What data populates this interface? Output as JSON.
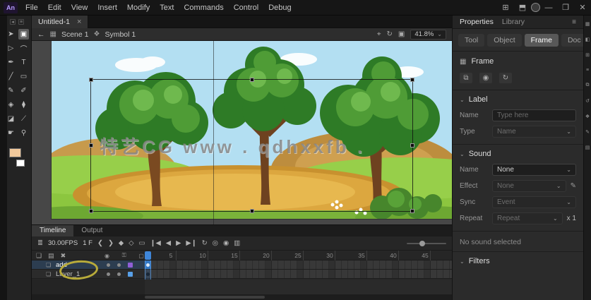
{
  "menubar": {
    "logo": "An",
    "items": [
      "File",
      "Edit",
      "View",
      "Insert",
      "Modify",
      "Text",
      "Commands",
      "Control",
      "Debug"
    ],
    "right_icons": [
      {
        "name": "workspace-icon",
        "glyph": "⊞"
      },
      {
        "name": "quick-share-icon",
        "glyph": "⬒"
      },
      {
        "name": "profile-avatar",
        "glyph": "",
        "avatar": true
      },
      {
        "name": "minimize-button",
        "glyph": "—"
      },
      {
        "name": "restore-button",
        "glyph": "❐"
      },
      {
        "name": "close-button",
        "glyph": "✕"
      }
    ]
  },
  "doc_tab": {
    "title": "Untitled-1",
    "close_glyph": "×"
  },
  "edit_bar": {
    "back_glyph": "←",
    "scene_icon": "▦",
    "scene_label": "Scene 1",
    "symbol_icon": "❖",
    "symbol_label": "Symbol 1",
    "right_icons": [
      {
        "name": "center-stage-icon",
        "glyph": "⌖"
      },
      {
        "name": "rotate-view-icon",
        "glyph": "↻"
      },
      {
        "name": "clip-content-icon",
        "glyph": "▣"
      }
    ],
    "zoom_value": "41.8%",
    "zoom_chevron": "⌄"
  },
  "tools": {
    "mini_icons": [
      {
        "name": "tools-collapse-icon",
        "glyph": "◂"
      },
      {
        "name": "tools-menu-icon",
        "glyph": "≡"
      }
    ],
    "items": [
      {
        "name": "selection-tool",
        "glyph": "➤"
      },
      {
        "name": "free-transform-tool",
        "glyph": "▣",
        "active": true
      },
      {
        "name": "subselection-tool",
        "glyph": "▷"
      },
      {
        "name": "lasso-tool",
        "glyph": "⌒"
      },
      {
        "name": "pen-tool",
        "glyph": "✒"
      },
      {
        "name": "text-tool",
        "glyph": "T"
      },
      {
        "name": "line-tool",
        "glyph": "╱"
      },
      {
        "name": "rectangle-tool",
        "glyph": "▭"
      },
      {
        "name": "pencil-tool",
        "glyph": "✎"
      },
      {
        "name": "brush-tool",
        "glyph": "✐"
      },
      {
        "name": "paint-bucket-tool",
        "glyph": "◈"
      },
      {
        "name": "eyedropper-tool",
        "glyph": "⧫"
      },
      {
        "name": "eraser-tool",
        "glyph": "◪"
      },
      {
        "name": "bone-tool",
        "glyph": "⟋"
      },
      {
        "name": "hand-tool",
        "glyph": "☛"
      },
      {
        "name": "zoom-tool",
        "glyph": "⚲"
      }
    ],
    "fill_color": "#f2c99b",
    "stroke_color": "#ffffff"
  },
  "stage": {
    "watermark": "特艺CG  www . qdhxxfb ."
  },
  "properties": {
    "panel_tabs": [
      {
        "label": "Properties",
        "active": true
      },
      {
        "label": "Library",
        "active": false
      }
    ],
    "menu_icon": "≡",
    "mode_tabs": [
      {
        "label": "Tool"
      },
      {
        "label": "Object"
      },
      {
        "label": "Frame",
        "active": true
      },
      {
        "label": "Doc"
      }
    ],
    "object": {
      "icon": "▦",
      "title": "Frame"
    },
    "frame_actions": [
      {
        "name": "swap-symbol-icon",
        "glyph": "⧉"
      },
      {
        "name": "visibility-icon",
        "glyph": "◉"
      },
      {
        "name": "refresh-icon",
        "glyph": "↻"
      }
    ],
    "label_section": {
      "title": "Label",
      "name_label": "Name",
      "name_placeholder": "Type here",
      "type_label": "Type",
      "type_value": "Name"
    },
    "sound_section": {
      "title": "Sound",
      "rows": [
        {
          "label": "Name",
          "value": "None",
          "dim": false
        },
        {
          "label": "Effect",
          "value": "None",
          "dim": true,
          "edit_icon": "✎"
        },
        {
          "label": "Sync",
          "value": "Event",
          "dim": true
        },
        {
          "label": "Repeat",
          "value": "Repeat",
          "dim": true,
          "extra": "x 1"
        }
      ],
      "status": "No sound selected"
    },
    "filters_section": {
      "title": "Filters"
    }
  },
  "right_strip": [
    {
      "name": "align-panel-icon",
      "glyph": "▦"
    },
    {
      "name": "color-panel-icon",
      "glyph": "◧"
    },
    {
      "name": "swatches-panel-icon",
      "glyph": "⊞"
    },
    {
      "name": "info-panel-icon",
      "glyph": "≡"
    },
    {
      "name": "transform-panel-icon",
      "glyph": "⧉"
    },
    {
      "name": "history-panel-icon",
      "glyph": "↺"
    },
    {
      "name": "components-panel-icon",
      "glyph": "❖"
    },
    {
      "name": "brushes-panel-icon",
      "glyph": "✎"
    },
    {
      "name": "libraries-panel-icon",
      "glyph": "▤"
    }
  ],
  "timeline": {
    "tabs": [
      {
        "label": "Timeline",
        "active": true
      },
      {
        "label": "Output",
        "active": false
      }
    ],
    "layers_icon": "≣",
    "fps": "30.00FPS",
    "frame_number": "1",
    "frame_unit": "F",
    "buttons": [
      {
        "name": "step-back-button",
        "glyph": "❮"
      },
      {
        "name": "step-forward-button",
        "glyph": "❯"
      },
      {
        "name": "insert-keyframe-button",
        "glyph": "◆"
      },
      {
        "name": "insert-blank-keyframe-button",
        "glyph": "◇"
      },
      {
        "name": "insert-frame-button",
        "glyph": "▭"
      },
      {
        "name": "go-to-first-frame-button",
        "glyph": "❙◀"
      },
      {
        "name": "prev-frame-button",
        "glyph": "◀"
      },
      {
        "name": "play-button",
        "glyph": "▶"
      },
      {
        "name": "next-frame-button",
        "glyph": "▶❙"
      },
      {
        "name": "loop-button",
        "glyph": "↻"
      },
      {
        "name": "onion-skin-button",
        "glyph": "◎"
      },
      {
        "name": "onion-outlines-button",
        "glyph": "◉"
      },
      {
        "name": "edit-multiple-frames-button",
        "glyph": "▥"
      }
    ],
    "layer_controls": [
      {
        "name": "new-layer-button",
        "glyph": "❏"
      },
      {
        "name": "new-folder-button",
        "glyph": "▤"
      },
      {
        "name": "delete-layer-button",
        "glyph": "✖"
      }
    ],
    "column_headers": [
      {
        "name": "show-hide-column-icon",
        "glyph": "◉"
      },
      {
        "name": "lock-column-icon",
        "glyph": "⚿"
      },
      {
        "name": "outline-column-icon",
        "glyph": "▢"
      }
    ],
    "ruler": [
      5,
      10,
      15,
      20,
      25,
      30,
      35,
      40,
      45
    ],
    "layers": [
      {
        "name": "add",
        "selected": true,
        "outline_color": "#8f5fd6"
      },
      {
        "name": "Layer_1",
        "selected": false,
        "outline_color": "#58a0e8"
      }
    ]
  },
  "annotation": {
    "shape": "ellipse",
    "color": "#b8ab3a"
  }
}
